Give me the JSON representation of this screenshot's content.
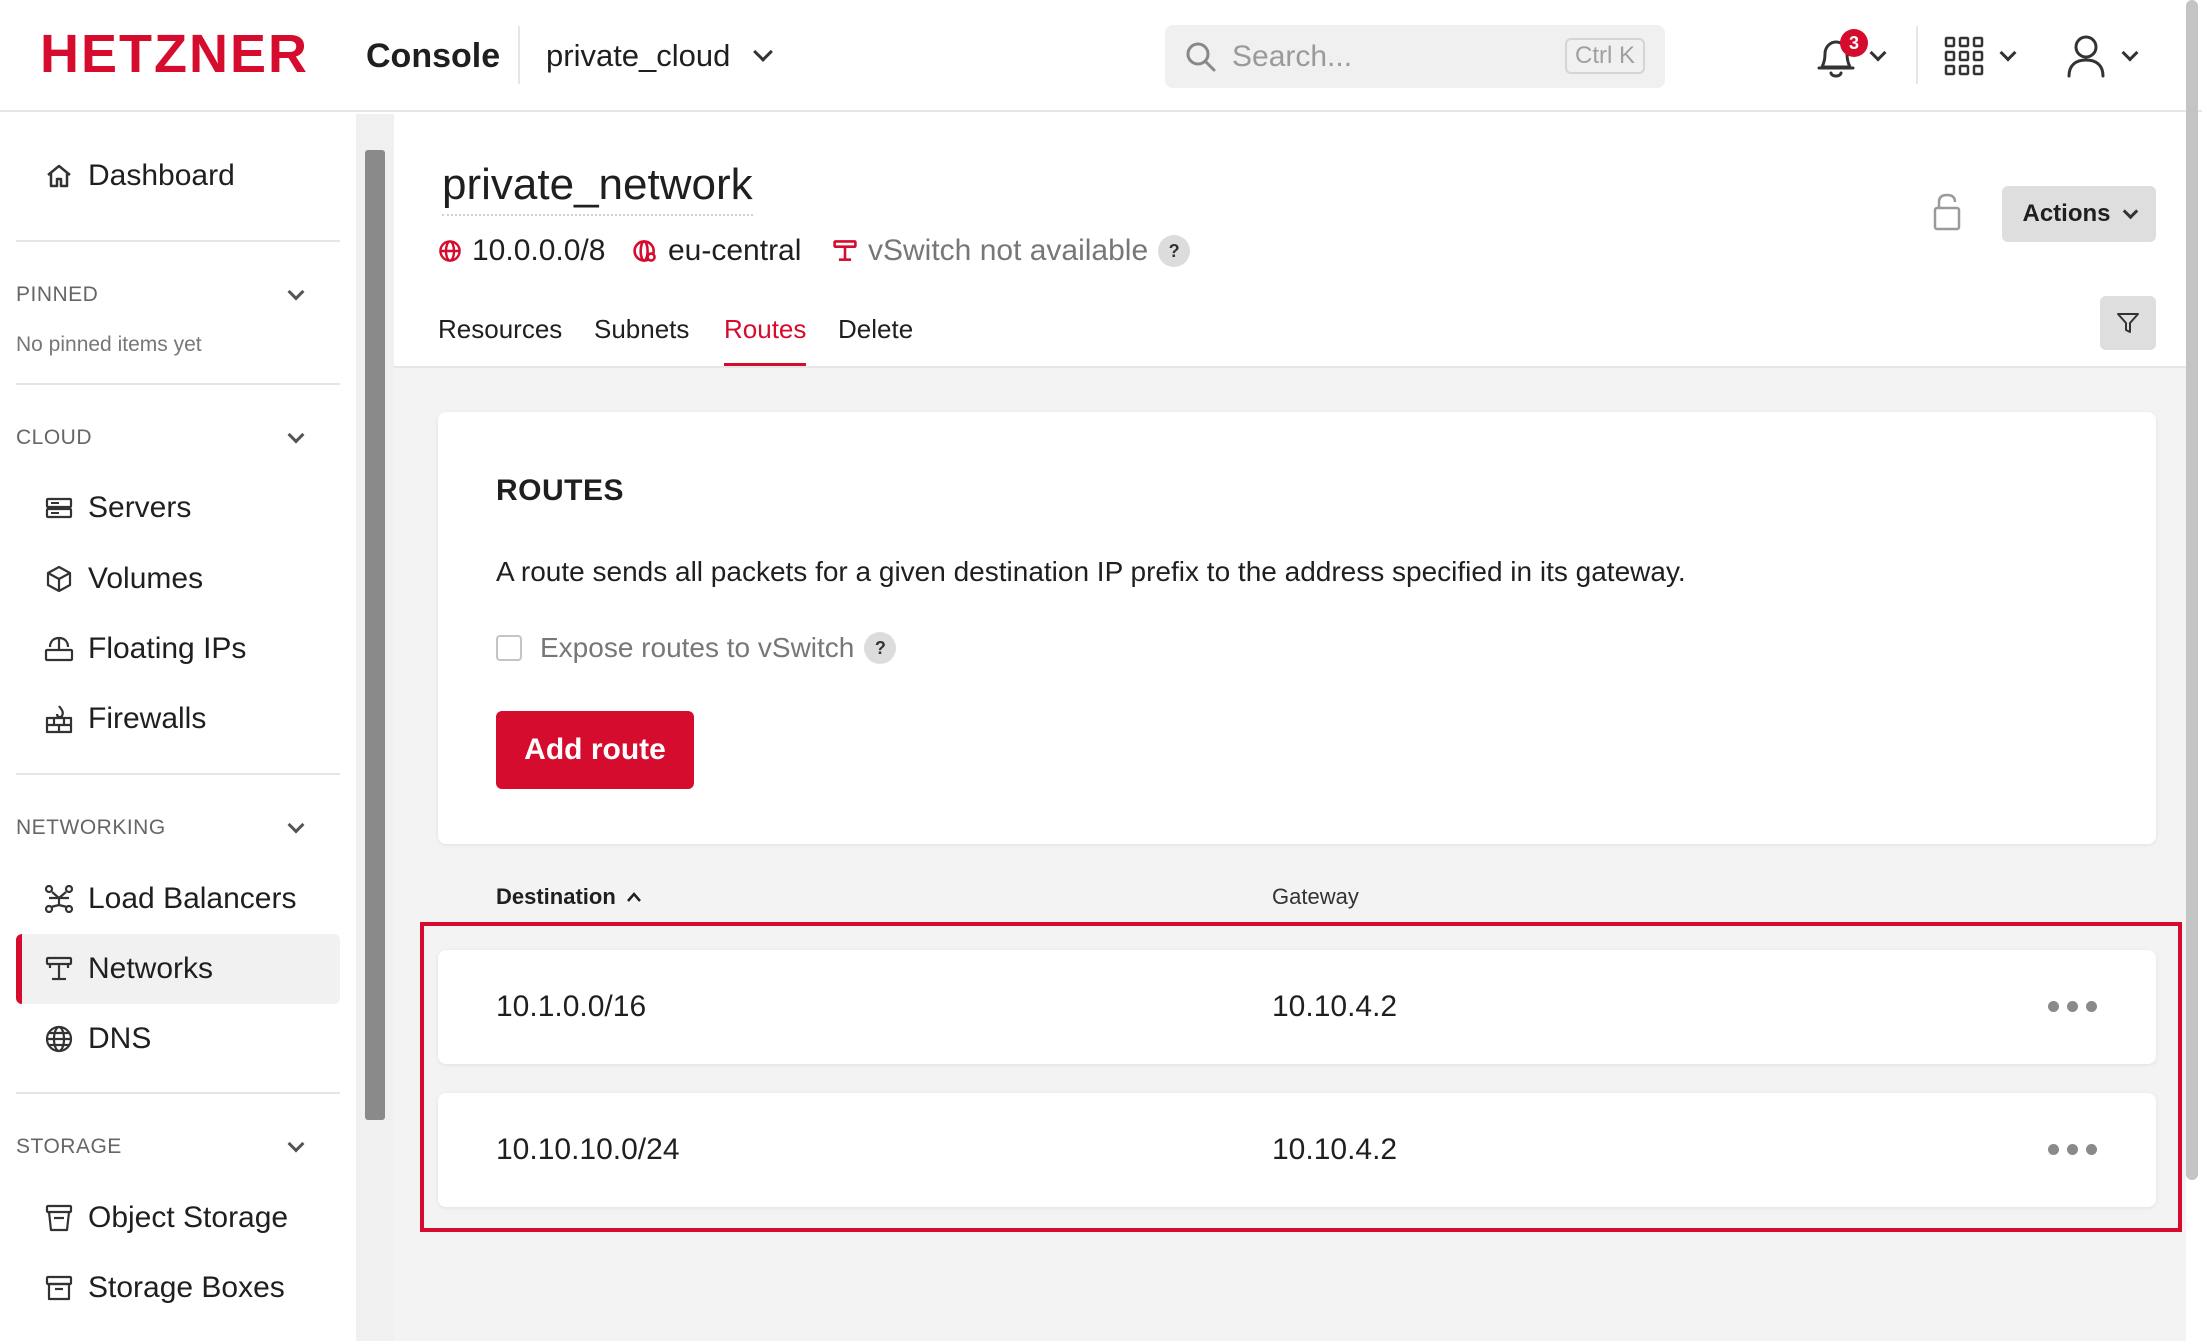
{
  "header": {
    "brand": "HETZNER",
    "console_label": "Console",
    "project": "private_cloud",
    "search_placeholder": "Search...",
    "search_shortcut": "Ctrl K",
    "notifications_count": "3"
  },
  "sidebar": {
    "dashboard": "Dashboard",
    "pinned_title": "PINNED",
    "no_pinned": "No pinned items yet",
    "cloud_title": "CLOUD",
    "cloud_items": [
      "Servers",
      "Volumes",
      "Floating IPs",
      "Firewalls"
    ],
    "networking_title": "NETWORKING",
    "networking_items": [
      "Load Balancers",
      "Networks",
      "DNS"
    ],
    "storage_title": "STORAGE",
    "storage_items": [
      "Object Storage",
      "Storage Boxes"
    ]
  },
  "page": {
    "title": "private_network",
    "ip_range": "10.0.0.0/8",
    "zone": "eu-central",
    "vswitch_status": "vSwitch not available",
    "help_symbol": "?",
    "actions_label": "Actions",
    "tabs": [
      "Resources",
      "Subnets",
      "Routes",
      "Delete"
    ],
    "active_tab": "Routes"
  },
  "routes": {
    "title": "ROUTES",
    "description": "A route sends all packets for a given destination IP prefix to the address specified in its gateway.",
    "expose_label": "Expose routes to vSwitch",
    "add_label": "Add route",
    "col_destination": "Destination",
    "col_gateway": "Gateway",
    "rows": [
      {
        "destination": "10.1.0.0/16",
        "gateway": "10.10.4.2"
      },
      {
        "destination": "10.10.10.0/24",
        "gateway": "10.10.4.2"
      }
    ]
  },
  "colors": {
    "brand_red": "#d50c2d",
    "background": "#f3f3f3"
  }
}
